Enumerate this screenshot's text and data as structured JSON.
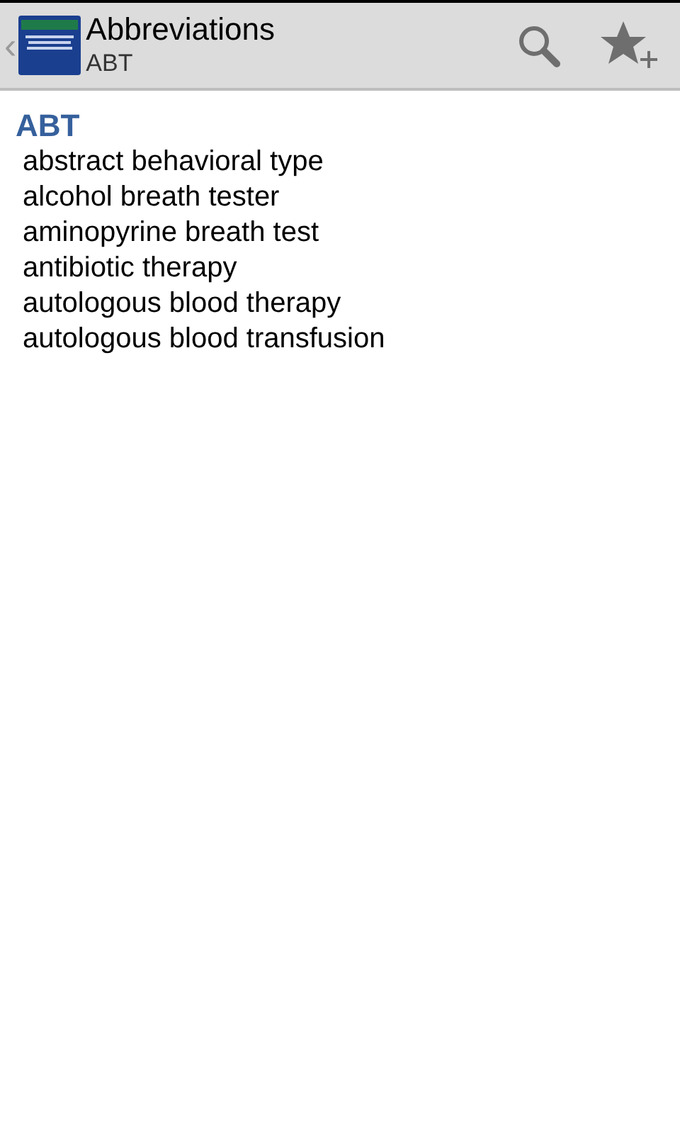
{
  "action_bar": {
    "back": "‹",
    "title": "Abbreviations",
    "subtitle": "ABT"
  },
  "entry": {
    "term": "ABT",
    "meanings": [
      "abstract behavioral type",
      "alcohol breath tester",
      "aminopyrine breath test",
      "antibiotic therapy",
      "autologous blood therapy",
      "autologous blood transfusion"
    ]
  }
}
